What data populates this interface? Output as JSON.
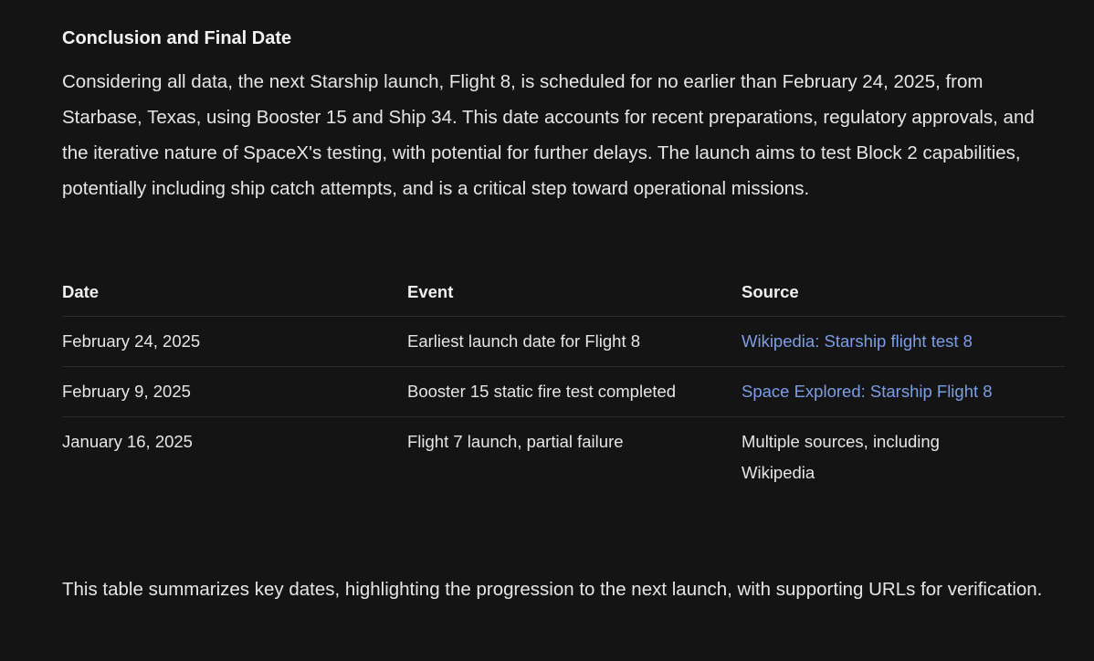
{
  "heading": "Conclusion and Final Date",
  "intro": "Considering all data, the next Starship launch, Flight 8, is scheduled for no earlier than February 24, 2025, from Starbase, Texas, using Booster 15 and Ship 34. This date accounts for recent preparations, regulatory approvals, and the iterative nature of SpaceX's testing, with potential for further delays. The launch aims to test Block 2 capabilities, potentially including ship catch attempts, and is a critical step toward operational missions.",
  "table": {
    "headers": [
      "Date",
      "Event",
      "Source"
    ],
    "rows": [
      {
        "date": "February 24, 2025",
        "event": "Earliest launch date for Flight 8",
        "source": "Wikipedia: Starship flight test 8",
        "source_is_link": true
      },
      {
        "date": "February 9, 2025",
        "event": "Booster 15 static fire test completed",
        "source": "Space Explored: Starship Flight 8",
        "source_is_link": true
      },
      {
        "date": "January 16, 2025",
        "event": "Flight 7 launch, partial failure",
        "source": "Multiple sources, including Wikipedia",
        "source_is_link": false
      }
    ]
  },
  "closing": "This table summarizes key dates, highlighting the progression to the next launch, with supporting URLs for verification.",
  "colors": {
    "background": "#141414",
    "text": "#e6e6e6",
    "link": "#7d9ee6",
    "divider": "#2d2d2d"
  }
}
